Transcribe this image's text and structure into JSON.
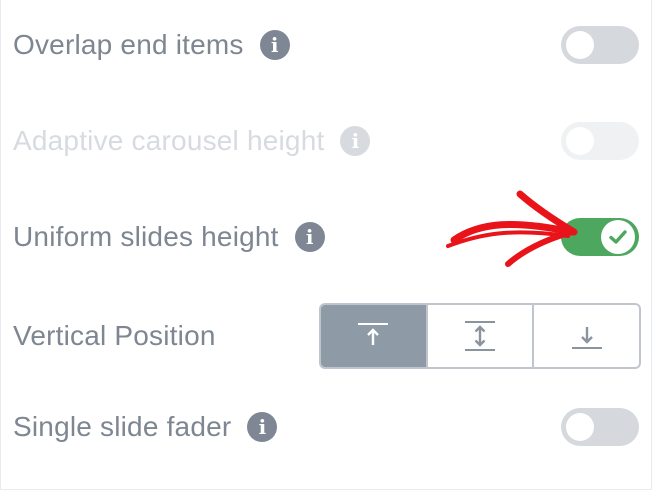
{
  "settings": {
    "overlap_end_items": {
      "label": "Overlap end items",
      "enabled": false
    },
    "adaptive_carousel_height": {
      "label": "Adaptive carousel height",
      "enabled": false,
      "disabled": true
    },
    "uniform_slides_height": {
      "label": "Uniform slides height",
      "enabled": true
    },
    "vertical_position": {
      "label": "Vertical Position",
      "options": [
        "top-align-icon",
        "center-align-icon",
        "bottom-align-icon"
      ],
      "selected": "top-align-icon"
    },
    "single_slide_fader": {
      "label": "Single slide fader",
      "enabled": false
    }
  },
  "colors": {
    "label": "#7d8691",
    "label_disabled": "#d7dbe0",
    "toggle_on": "#4ea75f",
    "toggle_off": "#d5d9de",
    "segment_active": "#8e9aa6",
    "annotation_arrow": "#e8141a"
  }
}
